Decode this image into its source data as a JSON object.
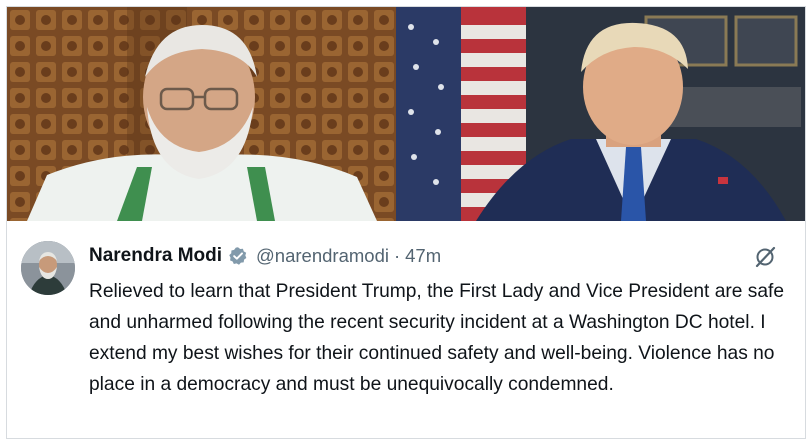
{
  "post": {
    "author_name": "Narendra Modi",
    "handle": "@narendramodi",
    "separator": "·",
    "timestamp": "47m",
    "text": "Relieved to learn that President Trump, the First Lady and Vice President are safe and unharmed following the recent security incident at a Washington DC hotel. I extend my best wishes for their continued safety and well-being. Violence has no place in a democracy and must be unequivocally condemned."
  },
  "icons": {
    "verified": "verified-badge-icon",
    "grok": "grok-slash-icon"
  },
  "colors": {
    "text_primary": "#0f1419",
    "text_secondary": "#536471",
    "verified_badge": "#829aab",
    "border": "#d7dbdf"
  }
}
